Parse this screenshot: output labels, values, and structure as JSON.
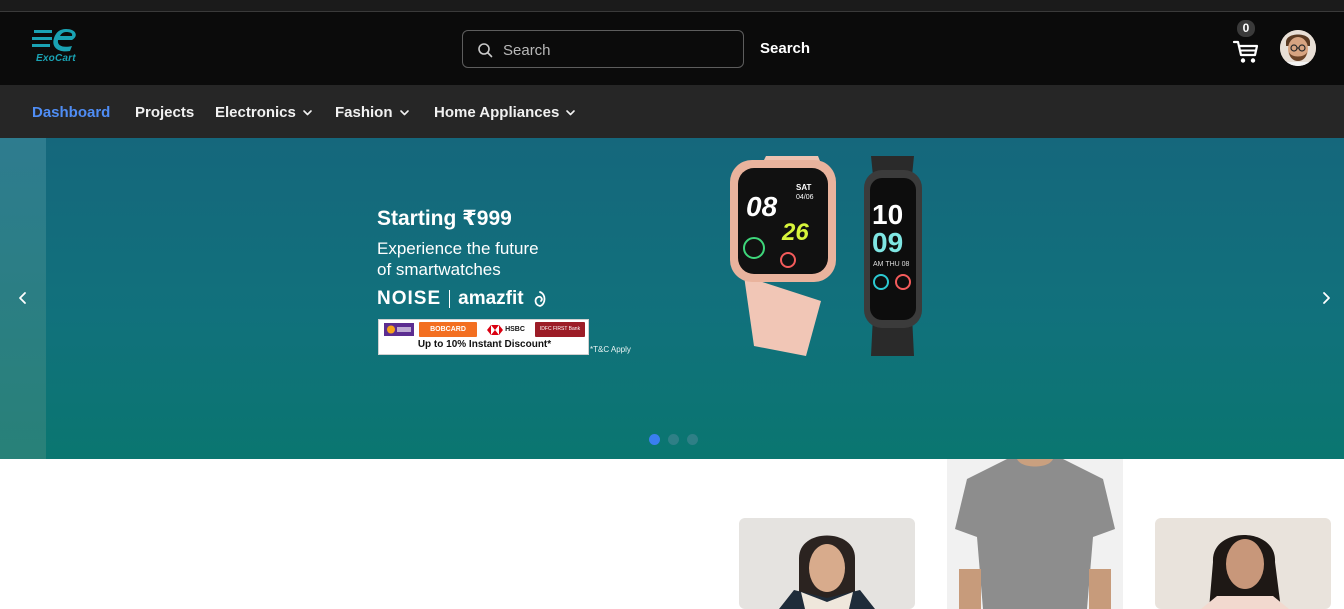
{
  "brand": {
    "name": "ExoCart",
    "accent": "#1aa3b4"
  },
  "search": {
    "placeholder": "Search",
    "button_label": "Search"
  },
  "cart": {
    "count": "0"
  },
  "nav": {
    "items": [
      {
        "label": "Dashboard",
        "active": true
      },
      {
        "label": "Projects"
      },
      {
        "label": "Electronics"
      },
      {
        "label": "Fashion"
      },
      {
        "label": "Home Appliances"
      }
    ]
  },
  "banner": {
    "title": "Starting ₹999",
    "subtitle_line1": "Experience the future",
    "subtitle_line2": "of smartwatches",
    "brand_1": "NOISE",
    "brand_2": "amazfit",
    "offer": "Up to 10% Instant Discount*",
    "bank_1": "BOBCARD",
    "bank_2": "HSBC",
    "bank_3": "IDFC FIRST Bank",
    "tc": "*T&C Apply",
    "watch_time_1": "08",
    "watch_time_2": "26",
    "watch_day": "SAT",
    "watch_date": "04/06",
    "band_hour": "10",
    "band_min": "09",
    "band_day": "AM THU 08",
    "slide_count": 3,
    "active_slide": 1,
    "colors": {
      "bg_top": "#15677c",
      "bg_bottom": "#0a7670",
      "dot_active": "#3a7ef0"
    }
  }
}
